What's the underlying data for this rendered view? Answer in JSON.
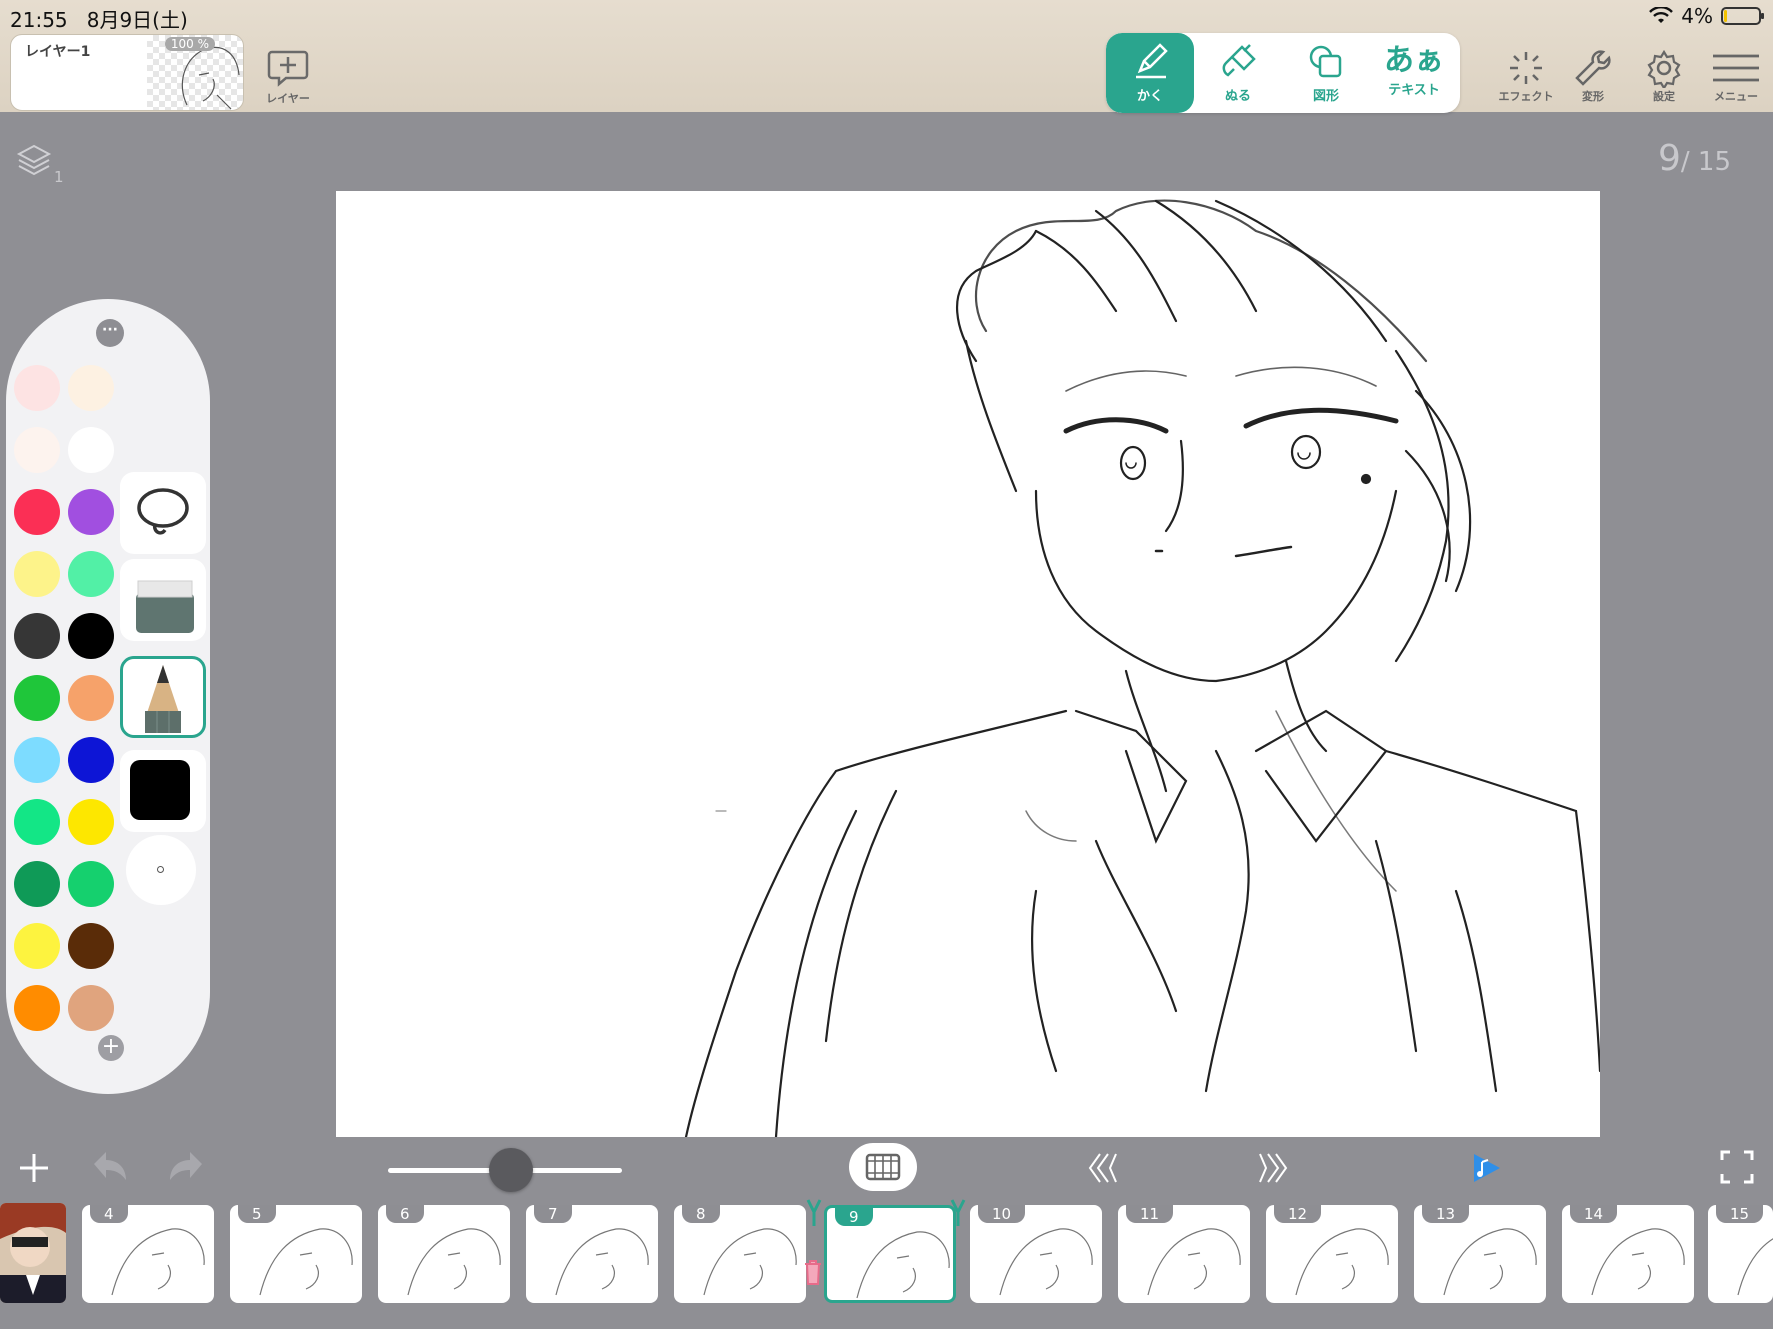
{
  "status": {
    "time": "21:55",
    "date": "8月9日(土)",
    "battery": "4%"
  },
  "layer": {
    "name": "レイヤー1",
    "opacity": "100 %",
    "add_label": "レイヤー"
  },
  "draw_tools": [
    {
      "label": "かく",
      "icon": "pencil-icon",
      "active": true
    },
    {
      "label": "ぬる",
      "icon": "brush-icon",
      "active": false
    },
    {
      "label": "図形",
      "icon": "shape-icon",
      "active": false
    },
    {
      "label": "テキスト",
      "icon": "text-icon",
      "glyph": "あぁ",
      "active": false
    }
  ],
  "right_tools": [
    {
      "label": "エフェクト",
      "icon": "sparkle-icon"
    },
    {
      "label": "変形",
      "icon": "wrench-icon"
    },
    {
      "label": "設定",
      "icon": "gear-icon"
    },
    {
      "label": "メニュー",
      "icon": "hamburger-icon"
    }
  ],
  "canvas": {
    "layer_count": "1",
    "page_current": "9",
    "page_total": "/ 15"
  },
  "palette": {
    "colors": [
      [
        "#fde3e3",
        "#fdf1e2"
      ],
      [
        "#fdf3ee",
        "#ffffff"
      ],
      [
        "#fb2f55",
        "#a14fe0"
      ],
      [
        "#fdf38a",
        "#52f0a6"
      ],
      [
        "#363636",
        "#000000"
      ],
      [
        "#1fc63a",
        "#f6a26a"
      ],
      [
        "#7ddcff",
        "#0d15d6"
      ],
      [
        "#13e686",
        "#fde700"
      ],
      [
        "#0f9a57",
        "#15d06e"
      ],
      [
        "#fdf33f",
        "#5a2c08"
      ],
      [
        "#ff8c00",
        "#e0a47e"
      ]
    ],
    "tools": [
      "lasso-icon",
      "eraser-icon",
      "pencil-tool-icon",
      "current-color-icon",
      "brush-size-icon"
    ],
    "current_color": "#000000"
  },
  "bottom": {
    "slider_value": 0.55,
    "frames": [
      {
        "num": "4"
      },
      {
        "num": "5"
      },
      {
        "num": "6"
      },
      {
        "num": "7"
      },
      {
        "num": "8"
      },
      {
        "num": "9",
        "current": true
      },
      {
        "num": "10"
      },
      {
        "num": "11"
      },
      {
        "num": "12"
      },
      {
        "num": "13"
      },
      {
        "num": "14"
      },
      {
        "num": "15"
      }
    ]
  },
  "colors": {
    "accent": "#2aa58e",
    "play": "#2f8fe8"
  }
}
